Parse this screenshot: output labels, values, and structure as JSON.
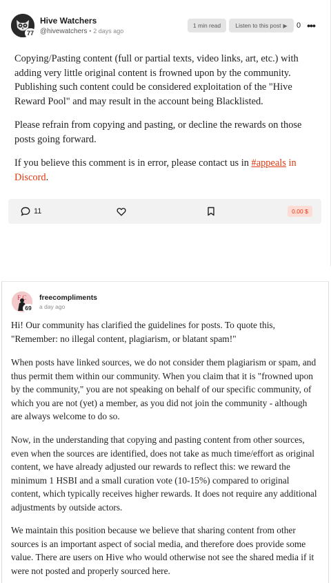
{
  "post": {
    "author": "Hive Watchers",
    "handle": "@hivewatchers",
    "separator": "•",
    "time": "2 days ago",
    "reputation": "77",
    "read_time": "1 min read",
    "listen_label": "Listen to this post",
    "listen_icon": "play-icon",
    "vote_count": "0",
    "more_label": "•••",
    "p1": "Copying/Pasting content (full or partial texts, video links, art, etc.) with adding very little original content is frowned upon by the community. Publishing such content could be considered exploitation of the \"Hive Reward Pool\" and may result in the account being Blacklisted.",
    "p2": "Please refrain from copying and pasting, or decline the rewards on those posts going forward.",
    "p3_prefix": "If you believe this comment is in error, please contact us in ",
    "p3_link1": "#appeals",
    "p3_mid": " in ",
    "p3_link2": "Discord",
    "p3_suffix": ".",
    "actions": {
      "comment_count": "11",
      "payout": "0.00 $"
    },
    "accent_color": "#e0380f"
  },
  "reply": {
    "author": "freecompliments",
    "time": "a day ago",
    "reputation": "69",
    "p1": "Hi! Our community has clarified the guidelines for posts. To quote this, \"Remember: no illegal content, plagiarism, or blatant spam!\"",
    "p2": "When posts have linked sources, we do not consider them plagiarism or spam, and thus permit them within our community. When you claim that it is \"frowned upon by the community,\" you are not speaking on behalf of our specific community, of which you are not (yet) a member, as you did not join the community - although are always welcome to do so.",
    "p3": "Now, in the understanding that copying and pasting content from other sources, even when the sources are identified, does not take as much time/effort as original content, we have already adjusted our rewards to reflect this: we reward the minimum 1 HSBI and a small curation vote (10-15%) compared to original content, which typically receives higher rewards. It does not require any additional adjustments by outside actors.",
    "p4": "We maintain this position because we believe that sharing content from other sources is an important aspect of social media, and therefore does provide some value. There are users on Hive who would otherwise not see the shared media if it were not posted and properly sourced here."
  }
}
